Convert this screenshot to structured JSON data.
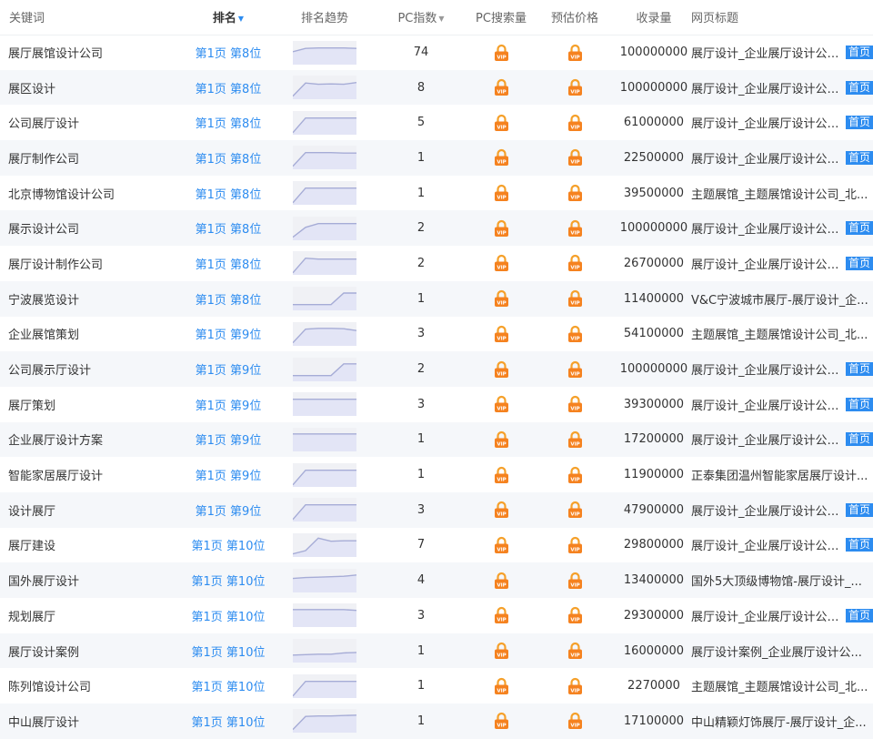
{
  "headers": {
    "keyword": "关键词",
    "rank": "排名",
    "trend": "排名趋势",
    "pc_index": "PC指数",
    "pc_search": "PC搜索量",
    "price": "预估价格",
    "indexed": "收录量",
    "page_title": "网页标题"
  },
  "icons": {
    "sort": "sort-caret-icon",
    "vip_lock": "vip-lock-icon"
  },
  "colors": {
    "rank_link": "#2d8cf0",
    "badge": "#2d8cf0",
    "vip_lock": "#f5821f",
    "trend_line": "#a6acd6",
    "trend_fill": "#e3e5f6",
    "row_stripe": "#f5f7fa"
  },
  "rows": [
    {
      "keyword": "展厅展馆设计公司",
      "rank": "第1页 第8位",
      "trend": [
        0.55,
        0.7,
        0.72,
        0.72,
        0.72,
        0.7
      ],
      "pc_index": "74",
      "indexed": "100000000",
      "title": "展厅设计_企业展厅设计公司_",
      "badge": "首页"
    },
    {
      "keyword": "展区设计",
      "rank": "第1页 第8位",
      "trend": [
        0.1,
        0.7,
        0.64,
        0.66,
        0.64,
        0.72
      ],
      "pc_index": "8",
      "indexed": "100000000",
      "title": "展厅设计_企业展厅设计公司_",
      "badge": "首页"
    },
    {
      "keyword": "公司展厅设计",
      "rank": "第1页 第8位",
      "trend": [
        0.05,
        0.72,
        0.72,
        0.72,
        0.72,
        0.72
      ],
      "pc_index": "5",
      "indexed": "61000000",
      "title": "展厅设计_企业展厅设计公司_",
      "badge": "首页"
    },
    {
      "keyword": "展厅制作公司",
      "rank": "第1页 第8位",
      "trend": [
        0.1,
        0.72,
        0.72,
        0.72,
        0.7,
        0.7
      ],
      "pc_index": "1",
      "indexed": "22500000",
      "title": "展厅设计_企业展厅设计公司_",
      "badge": "首页"
    },
    {
      "keyword": "北京博物馆设计公司",
      "rank": "第1页 第8位",
      "trend": [
        0.05,
        0.72,
        0.72,
        0.72,
        0.72,
        0.72
      ],
      "pc_index": "1",
      "indexed": "39500000",
      "title": "主题展馆_主题展馆设计公司_北...",
      "badge": ""
    },
    {
      "keyword": "展示设计公司",
      "rank": "第1页 第8位",
      "trend": [
        0.1,
        0.55,
        0.72,
        0.72,
        0.72,
        0.72
      ],
      "pc_index": "2",
      "indexed": "100000000",
      "title": "展厅设计_企业展厅设计公司_",
      "badge": "首页"
    },
    {
      "keyword": "展厅设计制作公司",
      "rank": "第1页 第8位",
      "trend": [
        0.05,
        0.72,
        0.68,
        0.68,
        0.68,
        0.68
      ],
      "pc_index": "2",
      "indexed": "26700000",
      "title": "展厅设计_企业展厅设计公司_",
      "badge": "首页"
    },
    {
      "keyword": "宁波展览设计",
      "rank": "第1页 第8位",
      "trend": [
        0.22,
        0.22,
        0.22,
        0.22,
        0.75,
        0.75
      ],
      "pc_index": "1",
      "indexed": "11400000",
      "title": "V&C宁波城市展厅-展厅设计_企...",
      "badge": ""
    },
    {
      "keyword": "企业展馆策划",
      "rank": "第1页 第9位",
      "trend": [
        0.1,
        0.72,
        0.76,
        0.76,
        0.74,
        0.66
      ],
      "pc_index": "3",
      "indexed": "54100000",
      "title": "主题展馆_主题展馆设计公司_北...",
      "badge": ""
    },
    {
      "keyword": "公司展示厅设计",
      "rank": "第1页 第9位",
      "trend": [
        0.22,
        0.22,
        0.22,
        0.22,
        0.76,
        0.76
      ],
      "pc_index": "2",
      "indexed": "100000000",
      "title": "展厅设计_企业展厅设计公司_",
      "badge": "首页"
    },
    {
      "keyword": "展厅策划",
      "rank": "第1页 第9位",
      "trend": [
        0.72,
        0.72,
        0.72,
        0.72,
        0.72,
        0.72
      ],
      "pc_index": "3",
      "indexed": "39300000",
      "title": "展厅设计_企业展厅设计公司_",
      "badge": "首页"
    },
    {
      "keyword": "企业展厅设计方案",
      "rank": "第1页 第9位",
      "trend": [
        0.76,
        0.76,
        0.76,
        0.76,
        0.76,
        0.76
      ],
      "pc_index": "1",
      "indexed": "17200000",
      "title": "展厅设计_企业展厅设计公司_",
      "badge": "首页"
    },
    {
      "keyword": "智能家居展厅设计",
      "rank": "第1页 第9位",
      "trend": [
        0.05,
        0.72,
        0.72,
        0.72,
        0.72,
        0.72
      ],
      "pc_index": "1",
      "indexed": "11900000",
      "title": "正泰集团温州智能家居展厅设计...",
      "badge": ""
    },
    {
      "keyword": "设计展厅",
      "rank": "第1页 第9位",
      "trend": [
        0.05,
        0.72,
        0.72,
        0.72,
        0.72,
        0.72
      ],
      "pc_index": "3",
      "indexed": "47900000",
      "title": "展厅设计_企业展厅设计公司_",
      "badge": "首页"
    },
    {
      "keyword": "展厅建设",
      "rank": "第1页 第10位",
      "trend": [
        0.1,
        0.25,
        0.82,
        0.68,
        0.7,
        0.7
      ],
      "pc_index": "7",
      "indexed": "29800000",
      "title": "展厅设计_企业展厅设计公司_",
      "badge": "首页"
    },
    {
      "keyword": "国外展厅设计",
      "rank": "第1页 第10位",
      "trend": [
        0.6,
        0.64,
        0.66,
        0.68,
        0.7,
        0.76
      ],
      "pc_index": "4",
      "indexed": "13400000",
      "title": "国外5大顶级博物馆-展厅设计_...",
      "badge": ""
    },
    {
      "keyword": "规划展厅",
      "rank": "第1页 第10位",
      "trend": [
        0.76,
        0.76,
        0.76,
        0.76,
        0.76,
        0.72
      ],
      "pc_index": "3",
      "indexed": "29300000",
      "title": "展厅设计_企业展厅设计公司_",
      "badge": "首页"
    },
    {
      "keyword": "展厅设计案例",
      "rank": "第1页 第10位",
      "trend": [
        0.3,
        0.32,
        0.34,
        0.34,
        0.4,
        0.42
      ],
      "pc_index": "1",
      "indexed": "16000000",
      "title": "展厅设计案例_企业展厅设计公...",
      "badge": ""
    },
    {
      "keyword": "陈列馆设计公司",
      "rank": "第1页 第10位",
      "trend": [
        0.05,
        0.72,
        0.72,
        0.72,
        0.72,
        0.72
      ],
      "pc_index": "1",
      "indexed": "2270000",
      "title": "主题展馆_主题展馆设计公司_北...",
      "badge": ""
    },
    {
      "keyword": "中山展厅设计",
      "rank": "第1页 第10位",
      "trend": [
        0.1,
        0.7,
        0.72,
        0.72,
        0.74,
        0.76
      ],
      "pc_index": "1",
      "indexed": "17100000",
      "title": "中山精颖灯饰展厅-展厅设计_企...",
      "badge": ""
    }
  ]
}
